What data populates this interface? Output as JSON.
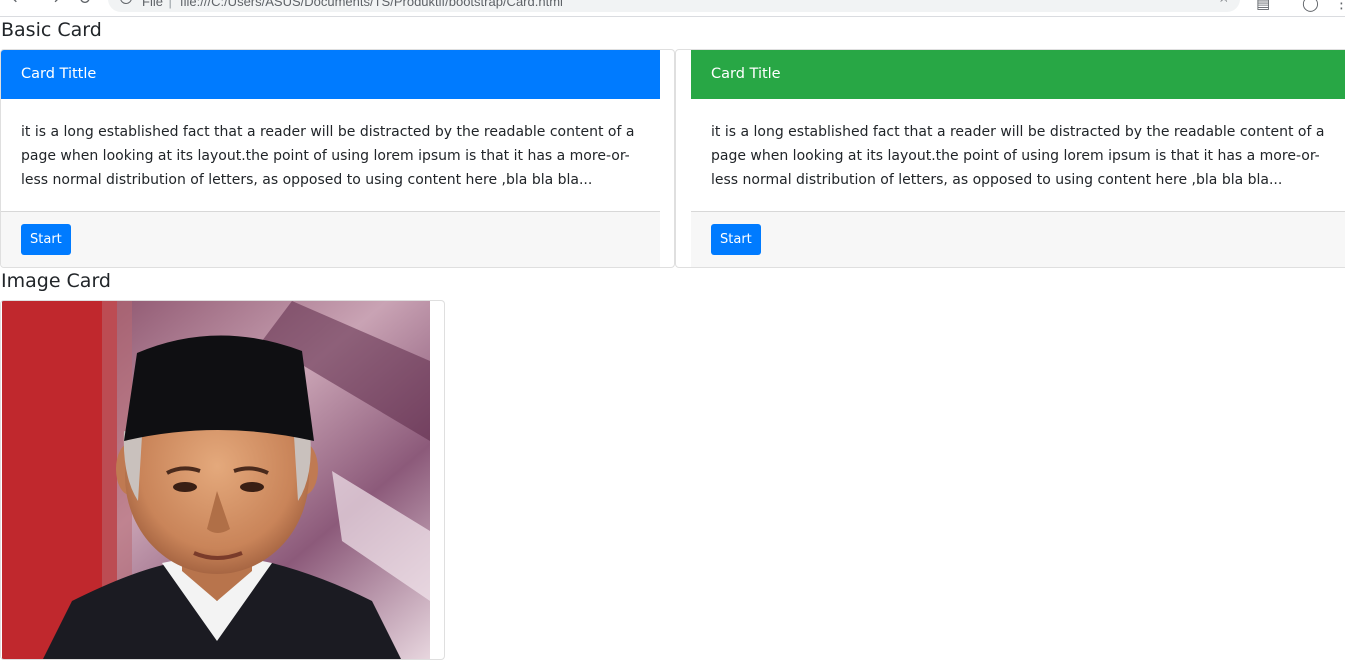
{
  "browser": {
    "scheme_label": "File",
    "url": "file:///C:/Users/ASUS/Documents/TS/Produktif/bootstrap/Card.html"
  },
  "basic_section": {
    "title": "Basic Card"
  },
  "cards": [
    {
      "header": "Card Tittle",
      "header_color": "#007bff",
      "body": "it is a long established fact that a reader will be distracted by the readable content of a page when looking at its layout.the point of using lorem ipsum is that it has a more-or-less normal distribution of letters, as opposed to using content here ,bla bla bla...",
      "button_label": "Start"
    },
    {
      "header": "Card Title",
      "header_color": "#28a745",
      "body": "it is a long established fact that a reader will be distracted by the readable content of a page when looking at its layout.the point of using lorem ipsum is that it has a more-or-less normal distribution of letters, as opposed to using content here ,bla bla bla...",
      "button_label": "Start"
    }
  ],
  "image_section": {
    "title": "Image Card"
  },
  "colors": {
    "primary": "#007bff",
    "success": "#28a745",
    "footer_bg": "#f7f7f7"
  },
  "icons": [
    "back-icon",
    "forward-icon",
    "reload-icon",
    "info-icon",
    "star-icon",
    "extension-icon",
    "account-icon",
    "menu-icon"
  ]
}
